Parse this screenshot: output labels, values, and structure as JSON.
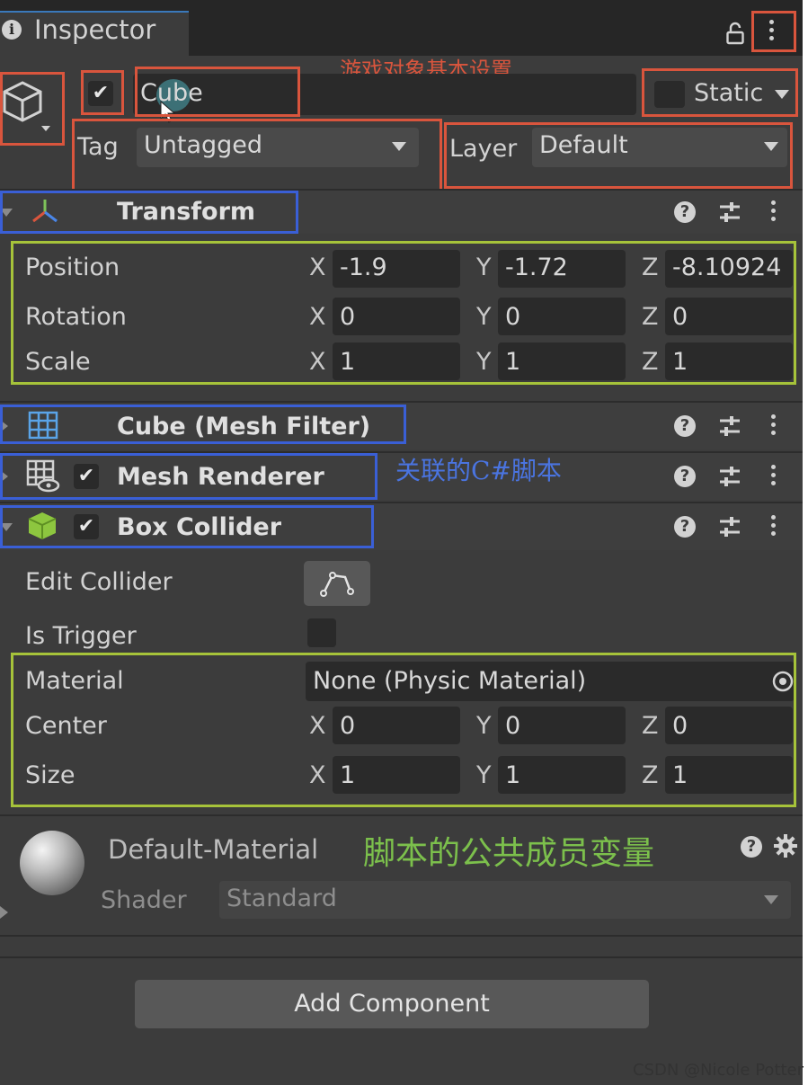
{
  "tab": {
    "title": "Inspector",
    "icon": "info-icon"
  },
  "annotations": {
    "basic_settings": "游戏对象基本设置",
    "linked_script": "关联的C#脚本",
    "public_members": "脚本的公共成员变量"
  },
  "object": {
    "active": true,
    "name": "Cube",
    "static_label": "Static",
    "static_checked": false,
    "tag_label": "Tag",
    "tag_value": "Untagged",
    "layer_label": "Layer",
    "layer_value": "Default"
  },
  "transform": {
    "title": "Transform",
    "rows": [
      {
        "label": "Position",
        "x": "-1.9",
        "y": "-1.72",
        "z": "-8.10924"
      },
      {
        "label": "Rotation",
        "x": "0",
        "y": "0",
        "z": "0"
      },
      {
        "label": "Scale",
        "x": "1",
        "y": "1",
        "z": "1"
      }
    ],
    "axis": {
      "x": "X",
      "y": "Y",
      "z": "Z"
    }
  },
  "mesh_filter": {
    "title": "Cube (Mesh Filter)"
  },
  "mesh_renderer": {
    "title": "Mesh Renderer",
    "enabled": true
  },
  "box_collider": {
    "title": "Box Collider",
    "enabled": true,
    "edit_collider_label": "Edit Collider",
    "is_trigger_label": "Is Trigger",
    "is_trigger": false,
    "material_label": "Material",
    "material_value": "None (Physic Material)",
    "center_label": "Center",
    "center": {
      "x": "0",
      "y": "0",
      "z": "0"
    },
    "size_label": "Size",
    "size": {
      "x": "1",
      "y": "1",
      "z": "1"
    }
  },
  "material": {
    "name": "Default-Material",
    "shader_label": "Shader",
    "shader_value": "Standard"
  },
  "add_component": "Add Component",
  "watermark": "CSDN @Nicole Potter",
  "colors": {
    "annotation_red": "#d9553d",
    "annotation_blue": "#3a5fd6",
    "annotation_green": "#a6c33a",
    "panel_bg": "#3c3c3c"
  }
}
